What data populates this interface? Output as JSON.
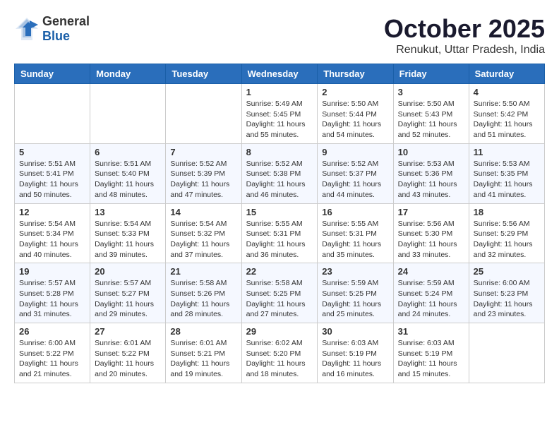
{
  "header": {
    "logo": {
      "general": "General",
      "blue": "Blue"
    },
    "month": "October 2025",
    "location": "Renukut, Uttar Pradesh, India"
  },
  "weekdays": [
    "Sunday",
    "Monday",
    "Tuesday",
    "Wednesday",
    "Thursday",
    "Friday",
    "Saturday"
  ],
  "weeks": [
    [
      {
        "day": "",
        "info": ""
      },
      {
        "day": "",
        "info": ""
      },
      {
        "day": "",
        "info": ""
      },
      {
        "day": "1",
        "info": "Sunrise: 5:49 AM\nSunset: 5:45 PM\nDaylight: 11 hours\nand 55 minutes."
      },
      {
        "day": "2",
        "info": "Sunrise: 5:50 AM\nSunset: 5:44 PM\nDaylight: 11 hours\nand 54 minutes."
      },
      {
        "day": "3",
        "info": "Sunrise: 5:50 AM\nSunset: 5:43 PM\nDaylight: 11 hours\nand 52 minutes."
      },
      {
        "day": "4",
        "info": "Sunrise: 5:50 AM\nSunset: 5:42 PM\nDaylight: 11 hours\nand 51 minutes."
      }
    ],
    [
      {
        "day": "5",
        "info": "Sunrise: 5:51 AM\nSunset: 5:41 PM\nDaylight: 11 hours\nand 50 minutes."
      },
      {
        "day": "6",
        "info": "Sunrise: 5:51 AM\nSunset: 5:40 PM\nDaylight: 11 hours\nand 48 minutes."
      },
      {
        "day": "7",
        "info": "Sunrise: 5:52 AM\nSunset: 5:39 PM\nDaylight: 11 hours\nand 47 minutes."
      },
      {
        "day": "8",
        "info": "Sunrise: 5:52 AM\nSunset: 5:38 PM\nDaylight: 11 hours\nand 46 minutes."
      },
      {
        "day": "9",
        "info": "Sunrise: 5:52 AM\nSunset: 5:37 PM\nDaylight: 11 hours\nand 44 minutes."
      },
      {
        "day": "10",
        "info": "Sunrise: 5:53 AM\nSunset: 5:36 PM\nDaylight: 11 hours\nand 43 minutes."
      },
      {
        "day": "11",
        "info": "Sunrise: 5:53 AM\nSunset: 5:35 PM\nDaylight: 11 hours\nand 41 minutes."
      }
    ],
    [
      {
        "day": "12",
        "info": "Sunrise: 5:54 AM\nSunset: 5:34 PM\nDaylight: 11 hours\nand 40 minutes."
      },
      {
        "day": "13",
        "info": "Sunrise: 5:54 AM\nSunset: 5:33 PM\nDaylight: 11 hours\nand 39 minutes."
      },
      {
        "day": "14",
        "info": "Sunrise: 5:54 AM\nSunset: 5:32 PM\nDaylight: 11 hours\nand 37 minutes."
      },
      {
        "day": "15",
        "info": "Sunrise: 5:55 AM\nSunset: 5:31 PM\nDaylight: 11 hours\nand 36 minutes."
      },
      {
        "day": "16",
        "info": "Sunrise: 5:55 AM\nSunset: 5:31 PM\nDaylight: 11 hours\nand 35 minutes."
      },
      {
        "day": "17",
        "info": "Sunrise: 5:56 AM\nSunset: 5:30 PM\nDaylight: 11 hours\nand 33 minutes."
      },
      {
        "day": "18",
        "info": "Sunrise: 5:56 AM\nSunset: 5:29 PM\nDaylight: 11 hours\nand 32 minutes."
      }
    ],
    [
      {
        "day": "19",
        "info": "Sunrise: 5:57 AM\nSunset: 5:28 PM\nDaylight: 11 hours\nand 31 minutes."
      },
      {
        "day": "20",
        "info": "Sunrise: 5:57 AM\nSunset: 5:27 PM\nDaylight: 11 hours\nand 29 minutes."
      },
      {
        "day": "21",
        "info": "Sunrise: 5:58 AM\nSunset: 5:26 PM\nDaylight: 11 hours\nand 28 minutes."
      },
      {
        "day": "22",
        "info": "Sunrise: 5:58 AM\nSunset: 5:25 PM\nDaylight: 11 hours\nand 27 minutes."
      },
      {
        "day": "23",
        "info": "Sunrise: 5:59 AM\nSunset: 5:25 PM\nDaylight: 11 hours\nand 25 minutes."
      },
      {
        "day": "24",
        "info": "Sunrise: 5:59 AM\nSunset: 5:24 PM\nDaylight: 11 hours\nand 24 minutes."
      },
      {
        "day": "25",
        "info": "Sunrise: 6:00 AM\nSunset: 5:23 PM\nDaylight: 11 hours\nand 23 minutes."
      }
    ],
    [
      {
        "day": "26",
        "info": "Sunrise: 6:00 AM\nSunset: 5:22 PM\nDaylight: 11 hours\nand 21 minutes."
      },
      {
        "day": "27",
        "info": "Sunrise: 6:01 AM\nSunset: 5:22 PM\nDaylight: 11 hours\nand 20 minutes."
      },
      {
        "day": "28",
        "info": "Sunrise: 6:01 AM\nSunset: 5:21 PM\nDaylight: 11 hours\nand 19 minutes."
      },
      {
        "day": "29",
        "info": "Sunrise: 6:02 AM\nSunset: 5:20 PM\nDaylight: 11 hours\nand 18 minutes."
      },
      {
        "day": "30",
        "info": "Sunrise: 6:03 AM\nSunset: 5:19 PM\nDaylight: 11 hours\nand 16 minutes."
      },
      {
        "day": "31",
        "info": "Sunrise: 6:03 AM\nSunset: 5:19 PM\nDaylight: 11 hours\nand 15 minutes."
      },
      {
        "day": "",
        "info": ""
      }
    ]
  ]
}
